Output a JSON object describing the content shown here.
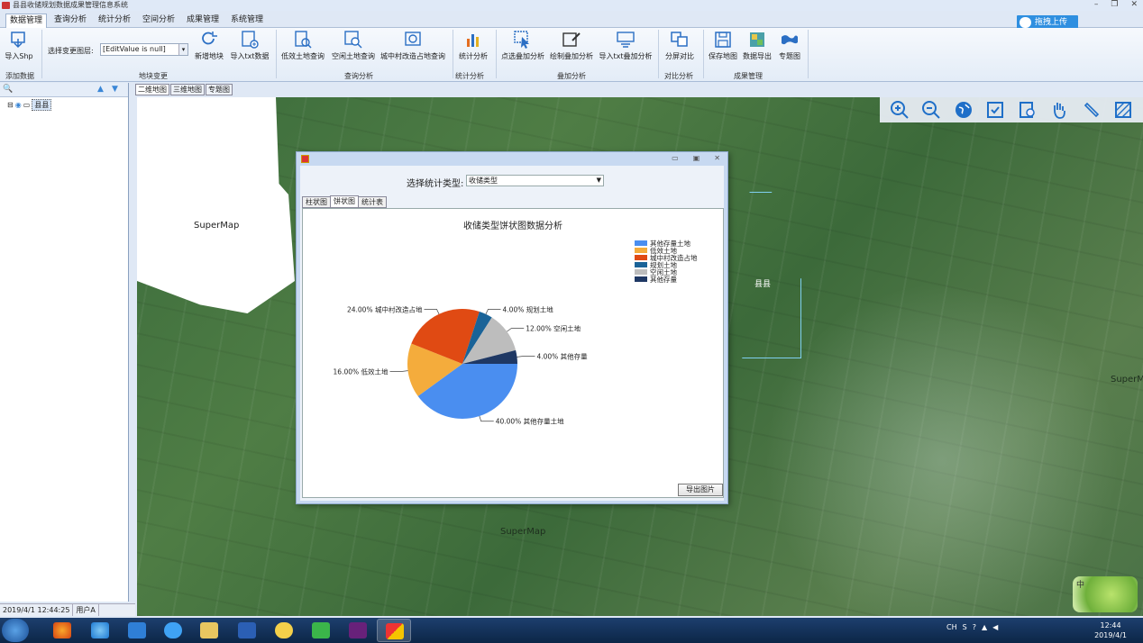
{
  "app": {
    "title": "县县收储规划数据成果管理信息系统",
    "menu_tabs": [
      "数据管理",
      "查询分析",
      "统计分析",
      "空间分析",
      "成果管理",
      "系统管理"
    ],
    "upload_button": "拖拽上传"
  },
  "ribbon": {
    "import_shp": "导入Shp",
    "layer_label": "选择变更图层:",
    "layer_value": "[EditValue is null]",
    "add_parcel": "新增地块",
    "import_txt": "导入txt数据",
    "idle_land_query": "低效土地查询",
    "vacant_land_query": "空闲土地查询",
    "village_query": "城中村改造占地查询",
    "stat_analysis": "统计分析",
    "point_overlay": "点选叠加分析",
    "draw_overlay": "绘制叠加分析",
    "txt_overlay": "导入txt叠加分析",
    "split_compare": "分屏对比",
    "save_map": "保存地图",
    "data_export": "数据导出",
    "thematic_map": "专题图",
    "groups": [
      "添加数据",
      "地块变更",
      "查询分析",
      "统计分析",
      "叠加分析",
      "对比分析",
      "成果管理"
    ]
  },
  "left_panel": {
    "tree_root": "县县"
  },
  "map_tabs": [
    "二维地图",
    "三维地图",
    "专题图"
  ],
  "map": {
    "watermark": "SuperMap",
    "village_label": "县县"
  },
  "dialog": {
    "stat_type_label": "选择统计类型:",
    "stat_type_value": "收储类型",
    "tabs": [
      "柱状图",
      "饼状图",
      "统计表"
    ],
    "export_button": "导出图片"
  },
  "status": {
    "datetime": "2019/4/1 12:44:25",
    "user": "用户A"
  },
  "taskbar": {
    "time": "12:44",
    "date": "2019/4/1",
    "ime": "CH"
  },
  "chart_data": {
    "type": "pie",
    "title": "收储类型饼状图数据分析",
    "slices": [
      {
        "name": "其他存量土地",
        "value": 40,
        "label": "40.00% 其他存量土地",
        "color": "#4a8ef0"
      },
      {
        "name": "低效土地",
        "value": 16,
        "label": "16.00% 低效土地",
        "color": "#f4ac3c"
      },
      {
        "name": "城中村改造占地",
        "value": 24,
        "label": "24.00% 城中村改造占地",
        "color": "#e04a13"
      },
      {
        "name": "规划土地",
        "value": 4,
        "label": "4.00% 规划土地",
        "color": "#1a6398"
      },
      {
        "name": "空闲土地",
        "value": 12,
        "label": "12.00% 空闲土地",
        "color": "#bdbdbd"
      },
      {
        "name": "其他存量",
        "value": 4,
        "label": "4.00% 其他存量",
        "color": "#1f3864"
      }
    ],
    "legend_position": "top-right"
  }
}
